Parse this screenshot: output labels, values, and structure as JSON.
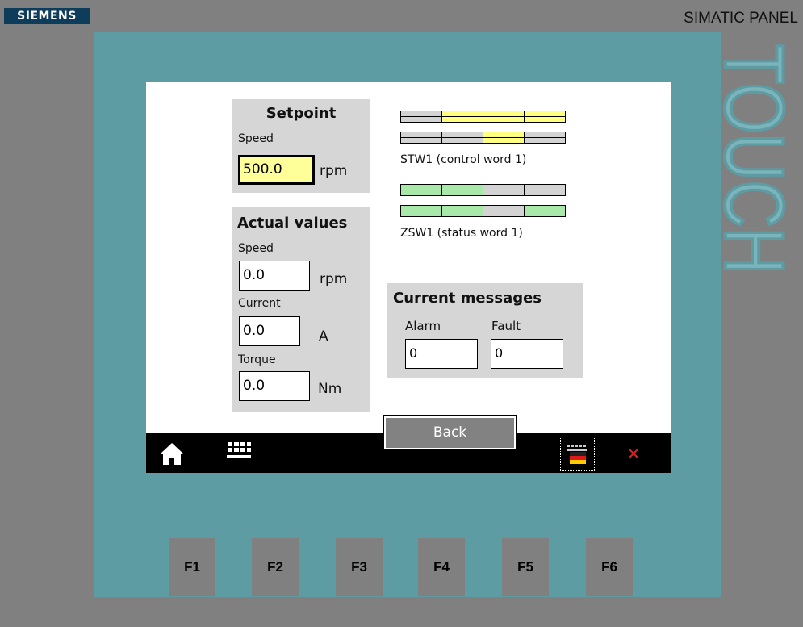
{
  "device": {
    "brand": "SIEMENS",
    "model": "SIMATIC PANEL",
    "touch_label": "TOUCH"
  },
  "setpoint": {
    "title": "Setpoint",
    "speed_label": "Speed",
    "speed_value": "500.0",
    "speed_unit": "rpm"
  },
  "actual": {
    "title": "Actual values",
    "speed_label": "Speed",
    "speed_value": "0.0",
    "speed_unit": "rpm",
    "current_label": "Current",
    "current_value": "0.0",
    "current_unit": "A",
    "torque_label": "Torque",
    "torque_value": "0.0",
    "torque_unit": "Nm"
  },
  "stw1": {
    "label": "STW1 (control word 1)",
    "row1": [
      "off",
      "on",
      "on",
      "on"
    ],
    "row2": [
      "off",
      "off",
      "on",
      "off"
    ]
  },
  "zsw1": {
    "label": "ZSW1 (status word 1)",
    "row1": [
      "on",
      "on",
      "off",
      "off"
    ],
    "row2": [
      "on",
      "on",
      "off",
      "on"
    ]
  },
  "messages": {
    "title": "Current messages",
    "alarm_label": "Alarm",
    "alarm_value": "0",
    "fault_label": "Fault",
    "fault_value": "0"
  },
  "nav": {
    "back_label": "Back",
    "home_icon": "home-icon",
    "keyboard_icon": "grid-icon",
    "language_icon": "language-flag-icon",
    "close_icon": "close-icon"
  },
  "function_keys": [
    "F1",
    "F2",
    "F3",
    "F4",
    "F5",
    "F6"
  ],
  "colors": {
    "bezel": "#5e9ca4",
    "bit_off": "#d3d3d3",
    "stw_on": "#ffff80",
    "zsw_on": "#a8e8a8",
    "input_highlight": "#ffff99",
    "close_red": "#e0201e"
  }
}
